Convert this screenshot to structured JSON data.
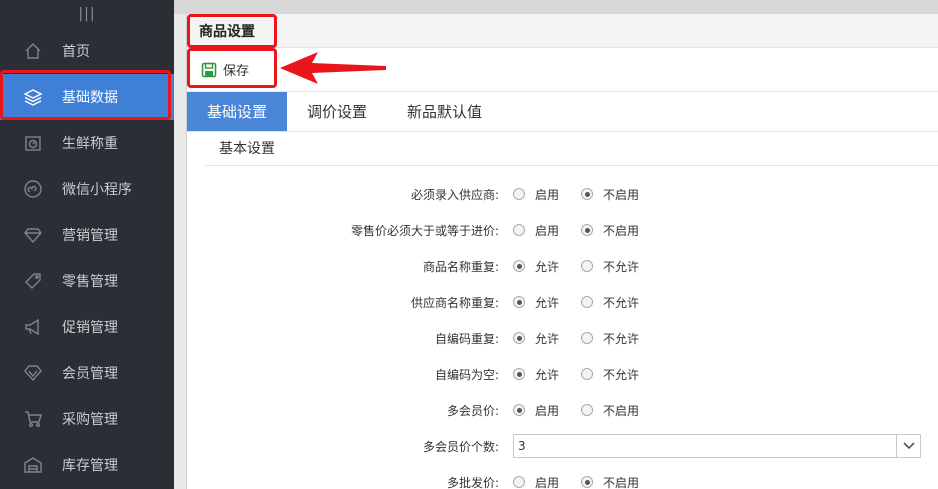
{
  "sidebar": {
    "grip": "|||",
    "items": [
      {
        "label": "首页",
        "icon": "home-icon"
      },
      {
        "label": "基础数据",
        "icon": "layers-icon",
        "active": true
      },
      {
        "label": "生鲜称重",
        "icon": "scale-icon"
      },
      {
        "label": "微信小程序",
        "icon": "mini-program-icon"
      },
      {
        "label": "营销管理",
        "icon": "diamond-icon"
      },
      {
        "label": "零售管理",
        "icon": "tag-icon"
      },
      {
        "label": "促销管理",
        "icon": "megaphone-icon"
      },
      {
        "label": "会员管理",
        "icon": "gem-icon"
      },
      {
        "label": "采购管理",
        "icon": "cart-icon"
      },
      {
        "label": "库存管理",
        "icon": "warehouse-icon"
      }
    ]
  },
  "header": {
    "title": "商品设置"
  },
  "toolbar": {
    "save_label": "保存"
  },
  "tabs": [
    {
      "label": "基础设置",
      "active": true
    },
    {
      "label": "调价设置"
    },
    {
      "label": "新品默认值"
    }
  ],
  "section_title": "基本设置",
  "form": {
    "rows": [
      {
        "label": "必须录入供应商:",
        "options": [
          "启用",
          "不启用"
        ],
        "selected": 1
      },
      {
        "label": "零售价必须大于或等于进价:",
        "options": [
          "启用",
          "不启用"
        ],
        "selected": 1
      },
      {
        "label": "商品名称重复:",
        "options": [
          "允许",
          "不允许"
        ],
        "selected": 0
      },
      {
        "label": "供应商名称重复:",
        "options": [
          "允许",
          "不允许"
        ],
        "selected": 0
      },
      {
        "label": "自编码重复:",
        "options": [
          "允许",
          "不允许"
        ],
        "selected": 0
      },
      {
        "label": "自编码为空:",
        "options": [
          "允许",
          "不允许"
        ],
        "selected": 0
      },
      {
        "label": "多会员价:",
        "options": [
          "启用",
          "不启用"
        ],
        "selected": 0
      }
    ],
    "member_price_count": {
      "label": "多会员价个数:",
      "value": "3"
    },
    "multi_wholesale": {
      "label": "多批发价:",
      "options": [
        "启用",
        "不启用"
      ],
      "selected": 1
    }
  },
  "colors": {
    "sidebar_bg": "#2b2f35",
    "active": "#3f7fd6",
    "highlight": "#e8151b",
    "save_icon": "#2e9a3a"
  }
}
